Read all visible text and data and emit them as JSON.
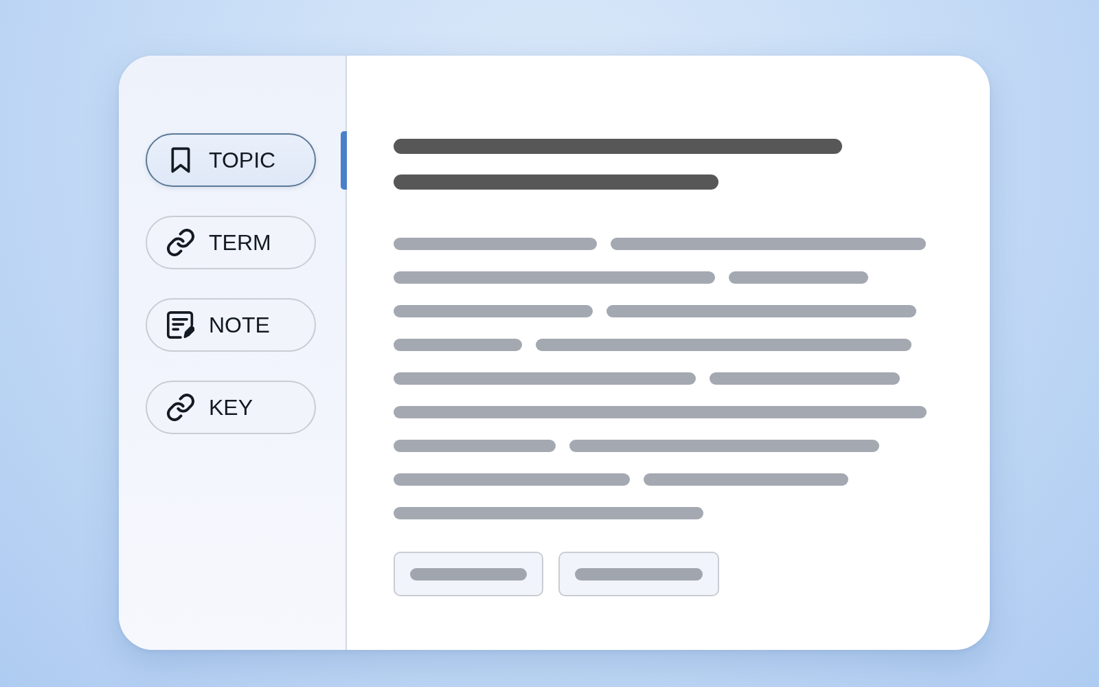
{
  "sidebar": {
    "items": [
      {
        "label": "TOPIC",
        "selected": true
      },
      {
        "label": "TERM",
        "selected": false
      },
      {
        "label": "NOTE",
        "selected": false
      },
      {
        "label": "KEY",
        "selected": false
      }
    ]
  }
}
